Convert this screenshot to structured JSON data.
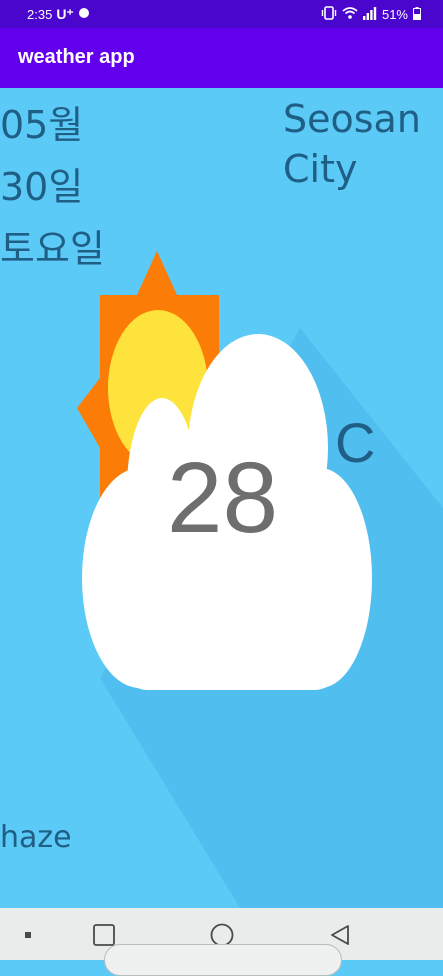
{
  "status_bar": {
    "time": "2:35",
    "carrier": "U⁺",
    "battery_percent": "51%",
    "icons": [
      "notification-icon",
      "vibrate-icon",
      "wifi-icon",
      "signal-icon",
      "battery-icon"
    ]
  },
  "app_bar": {
    "title": "weather app"
  },
  "date": {
    "month": "05월",
    "day": "30일",
    "weekday": "토요일"
  },
  "location": {
    "city_line1": "Seosan",
    "city_line2": "City"
  },
  "weather": {
    "temperature": "28",
    "unit": "C",
    "description": "haze",
    "icon": "partly-cloudy-icon"
  },
  "nav_bar": {
    "buttons": [
      "menu-dot-icon",
      "recents-icon",
      "home-icon",
      "back-icon"
    ]
  },
  "colors": {
    "status_bar": "#4a06cc",
    "app_bar": "#6200ee",
    "background": "#5ccaf6",
    "text": "#1f5f86",
    "temperature_text": "#6e6e6e",
    "sun_outer": "#fb7c06",
    "sun_inner": "#fde33b",
    "cloud": "#ffffff",
    "nav_bar": "#e8eceb"
  }
}
